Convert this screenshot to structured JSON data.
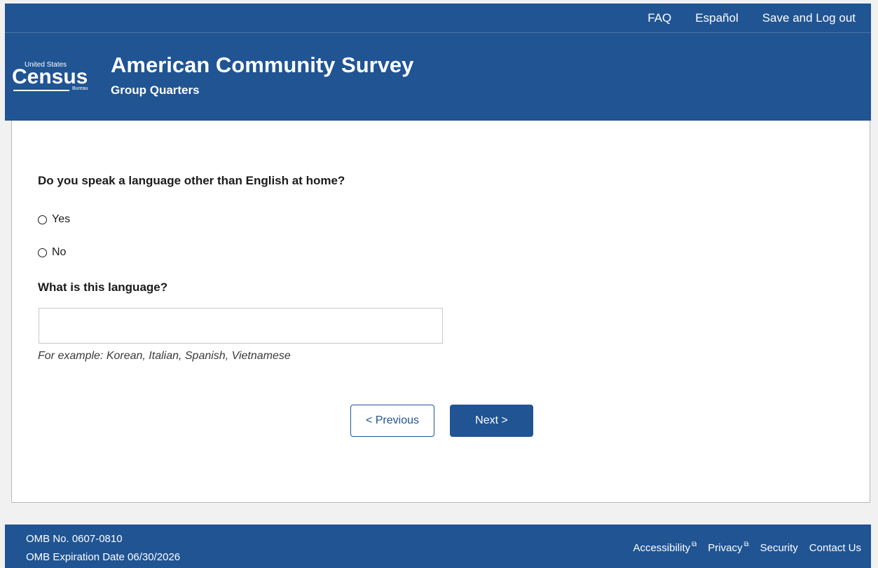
{
  "nav": {
    "faq": "FAQ",
    "espanol": "Español",
    "save_logout": "Save and Log out"
  },
  "header": {
    "logo_united_states": "United States",
    "logo_census": "Census",
    "logo_bureau": "Bureau",
    "title": "American Community Survey",
    "subtitle": "Group Quarters"
  },
  "form": {
    "question": "Do you speak a language other than English at home?",
    "options": [
      {
        "label": "Yes",
        "selected": false
      },
      {
        "label": "No",
        "selected": false
      }
    ],
    "sub_question": "What is this language?",
    "language_input_value": "",
    "hint": "For example: Korean, Italian, Spanish, Vietnamese",
    "previous_label": "< Previous",
    "next_label": "Next >"
  },
  "footer": {
    "omb_number": "OMB No. 0607-0810",
    "omb_expiration": "OMB Expiration Date 06/30/2026",
    "links": {
      "accessibility": "Accessibility",
      "privacy": "Privacy",
      "security": "Security",
      "contact": "Contact Us"
    }
  },
  "colors": {
    "brand_blue": "#205493",
    "background": "#f1f1f1",
    "panel": "#ffffff"
  },
  "icons": {
    "external_link": "external-link-icon",
    "radio": "radio-circle"
  }
}
